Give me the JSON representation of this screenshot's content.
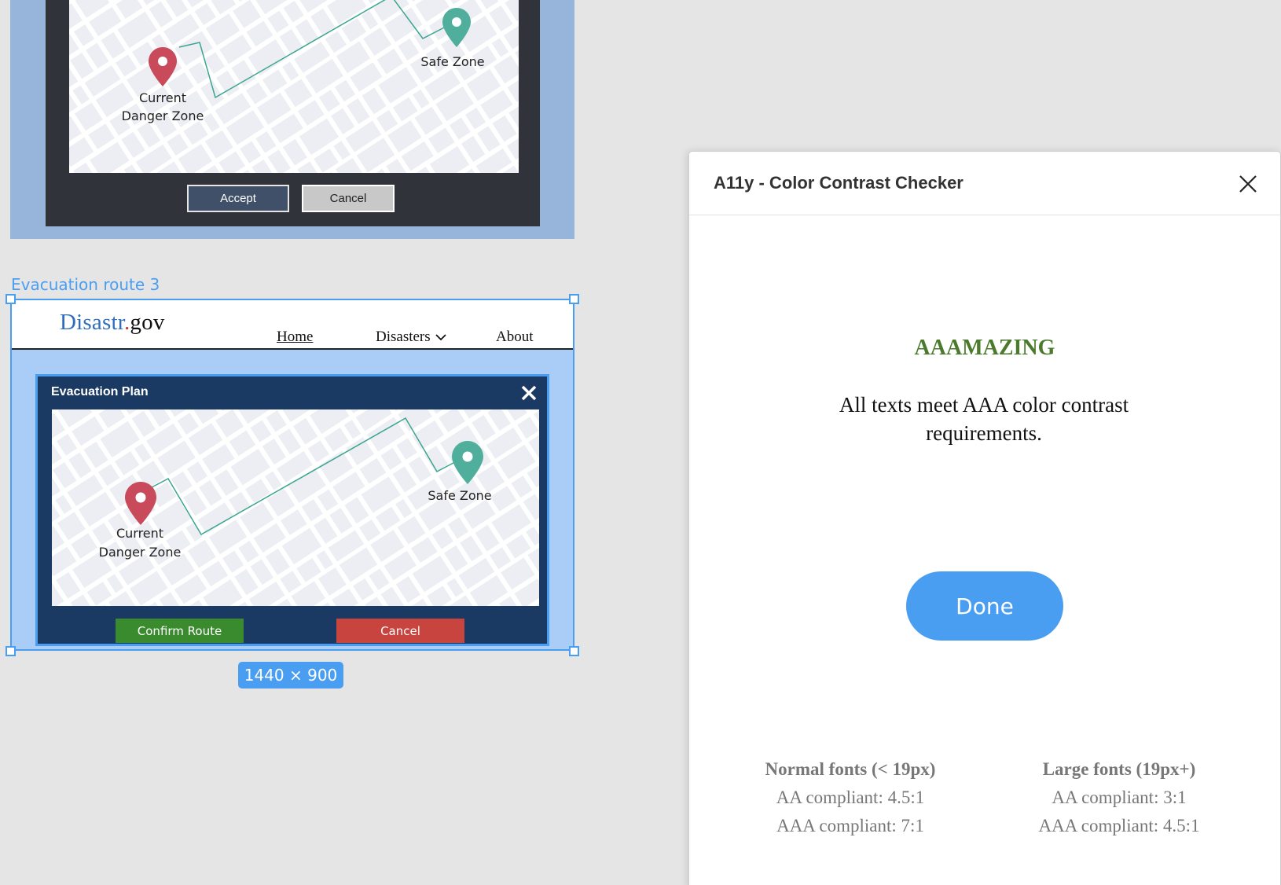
{
  "frame2": {
    "map": {
      "current_line1": "Current",
      "current_line2": "Danger Zone",
      "safe": "Safe Zone"
    },
    "accept_label": "Accept",
    "cancel_label": "Cancel"
  },
  "frame3": {
    "label": "Evacuation route 3",
    "size_badge": "1440 × 900",
    "site": {
      "logo_part1": "Disastr",
      "logo_part2": ".",
      "logo_part3": "gov",
      "nav": {
        "home": "Home",
        "disasters": "Disasters",
        "about": "About"
      }
    },
    "dialog": {
      "title": "Evacuation Plan",
      "map": {
        "current_line1": "Current",
        "current_line2": "Danger Zone",
        "safe": "Safe Zone"
      },
      "confirm_label": "Confirm Route",
      "cancel_label": "Cancel"
    }
  },
  "panel": {
    "title": "A11y - Color Contrast Checker",
    "result_title": "AAAMAZING",
    "result_message": "All texts meet AAA color contrast requirements.",
    "done_label": "Done",
    "legend": {
      "normal": {
        "heading": "Normal fonts (< 19px)",
        "aa": "AA compliant: 4.5:1",
        "aaa": "AAA compliant: 7:1"
      },
      "large": {
        "heading": "Large fonts (19px+)",
        "aa": "AA compliant: 3:1",
        "aaa": "AAA compliant: 4.5:1"
      }
    }
  },
  "colors": {
    "accent": "#4a9ef1",
    "danger_pin": "#c94a5a",
    "safe_pin": "#4fae9c",
    "dialog_bg": "#1b3a63",
    "confirm": "#3a8a2e",
    "cancel": "#c8443e",
    "success_text": "#4a7a2c"
  }
}
